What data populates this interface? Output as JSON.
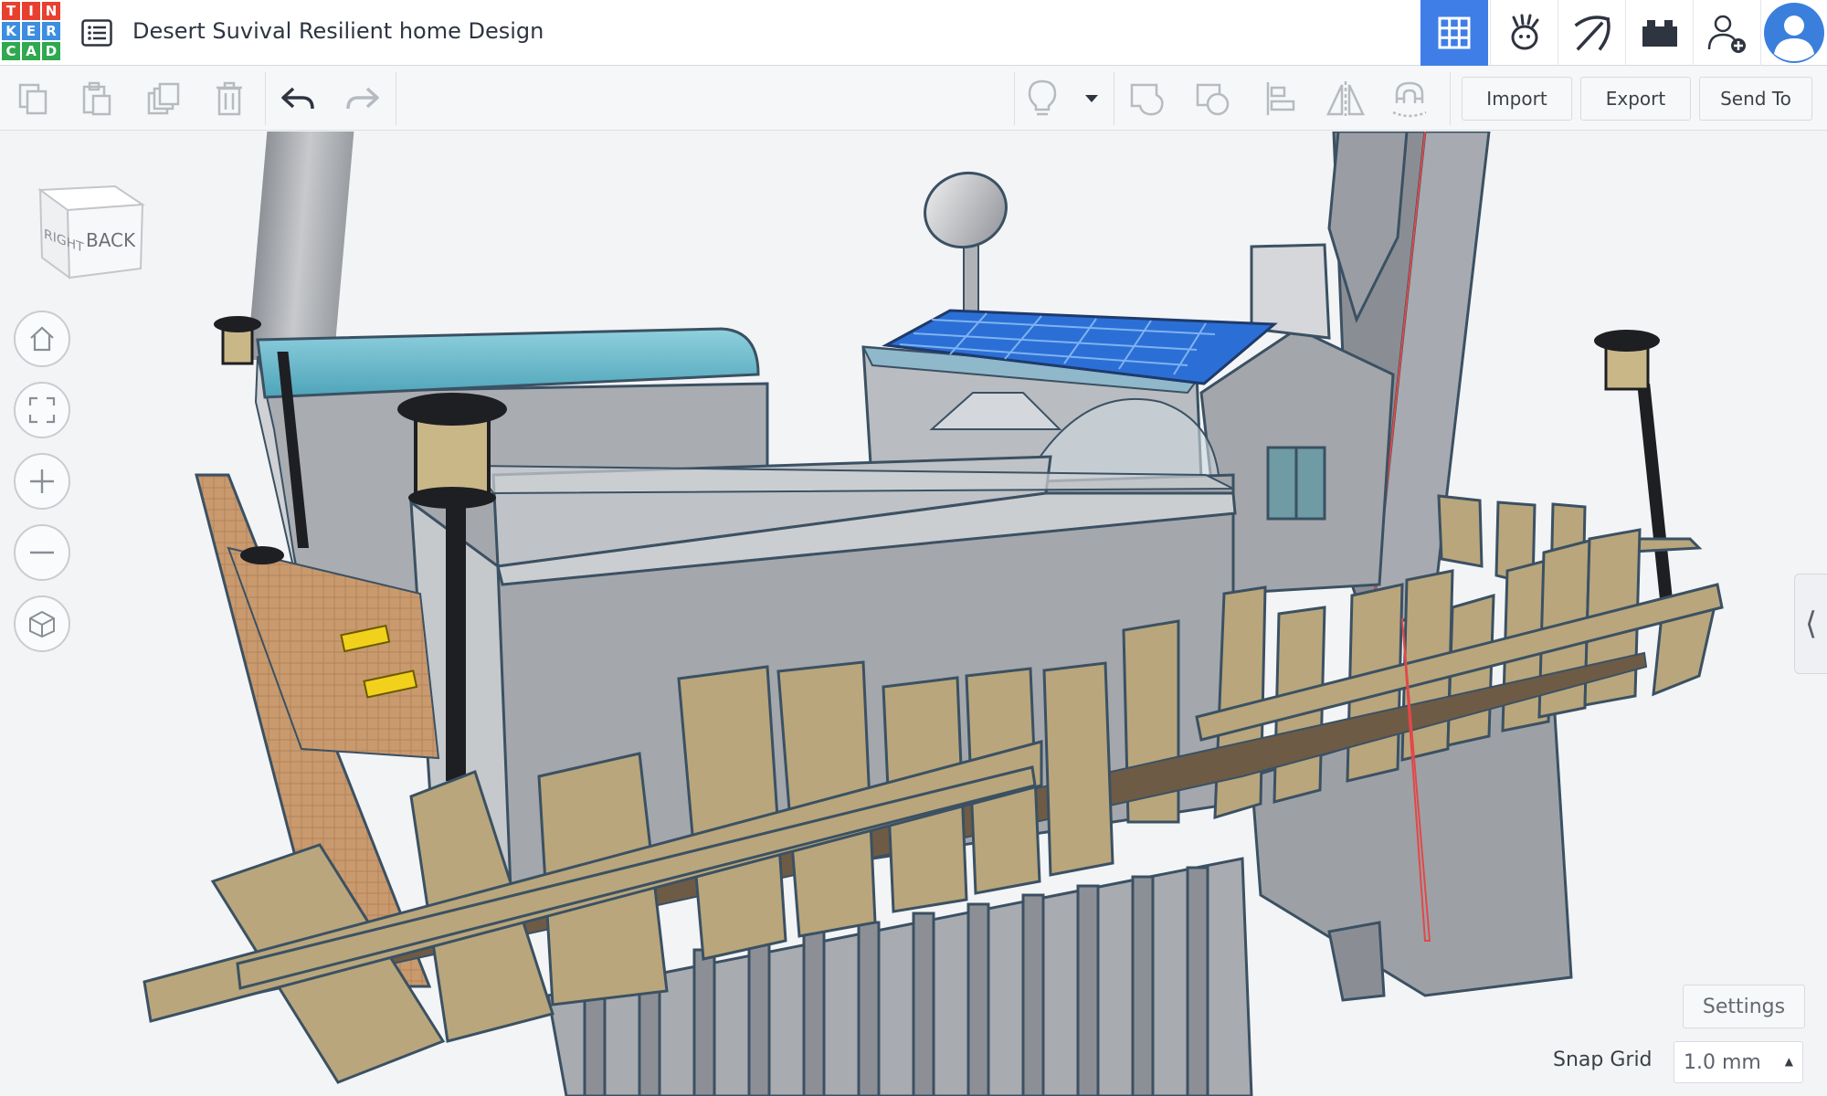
{
  "app": {
    "logo_letters": [
      "T",
      "I",
      "N",
      "K",
      "E",
      "R",
      "C",
      "A",
      "D"
    ],
    "logo_colors": [
      "#e8402f",
      "#e8402f",
      "#e8402f",
      "#3b8ee0",
      "#3b8ee0",
      "#3b8ee0",
      "#2fa84f",
      "#2fa84f",
      "#2fa84f"
    ],
    "design_title": "Desert Suvival Resilient home Design"
  },
  "header": {
    "icons": [
      "3d-design-grid-icon",
      "codeblocks-icon",
      "minecraft-pickaxe-icon",
      "bricks-icon",
      "invite-user-icon",
      "user-avatar-icon"
    ],
    "active_icon": "3d-design-grid-icon"
  },
  "toolbar": {
    "edit_tools": [
      "copy-icon",
      "paste-icon",
      "duplicate-icon",
      "delete-icon",
      "undo-icon",
      "redo-icon"
    ],
    "shape_tools": [
      "lightbulb-icon",
      "dropdown-caret-icon",
      "group-icon",
      "ungroup-icon",
      "align-icon",
      "mirror-icon",
      "cruise-magnet-icon"
    ],
    "import_label": "Import",
    "export_label": "Export",
    "send_to_label": "Send To"
  },
  "viewcube": {
    "face_front": "BACK",
    "face_side": "RIGHT"
  },
  "navigation": [
    "home-icon",
    "fit-all-icon",
    "zoom-in-icon",
    "zoom-out-icon",
    "ortho-view-icon"
  ],
  "viewport_footer": {
    "settings_label": "Settings",
    "snap_grid_label": "Snap Grid",
    "snap_grid_value": "1.0 mm"
  },
  "colors": {
    "accent": "#3f7ee6",
    "plank": "#b9a67c",
    "wall": "#9ea2a8",
    "roof_teal": "#6ab7c9",
    "solar": "#2b6fd6",
    "accent_yellow": "#f2d11c"
  }
}
